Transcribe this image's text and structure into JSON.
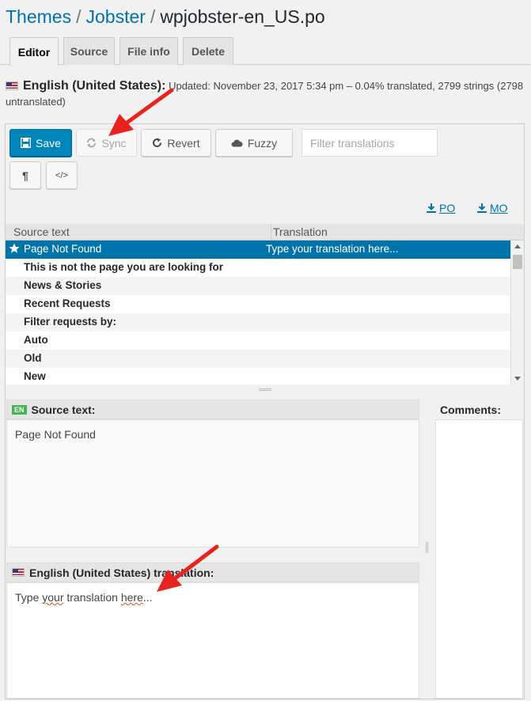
{
  "breadcrumb": {
    "item1": "Themes",
    "sep1": "/",
    "item2": "Jobster",
    "sep2": "/",
    "current": "wpjobster-en_US.po"
  },
  "tabs": [
    {
      "label": "Editor",
      "active": true
    },
    {
      "label": "Source",
      "active": false
    },
    {
      "label": "File info",
      "active": false
    },
    {
      "label": "Delete",
      "active": false
    }
  ],
  "status": {
    "language": "English (United States):",
    "details": "Updated: November 23, 2017 5:34 pm – 0.04% translated, 2799 strings (2798 untranslated)"
  },
  "toolbar": {
    "save_label": "Save",
    "sync_label": "Sync",
    "revert_label": "Revert",
    "fuzzy_label": "Fuzzy",
    "filter_placeholder": "Filter translations",
    "pilcrow_glyph": "¶",
    "code_glyph": "</>"
  },
  "downloads": {
    "po_label": "PO",
    "mo_label": "MO"
  },
  "list": {
    "header_source": "Source text",
    "header_translation": "Translation",
    "rows": [
      {
        "source": "Page Not Found",
        "translation": "Type your translation here...",
        "selected": true
      },
      {
        "source": "This is not the page you are looking for",
        "translation": ""
      },
      {
        "source": "News & Stories",
        "translation": ""
      },
      {
        "source": "Recent Requests",
        "translation": ""
      },
      {
        "source": "Filter requests by:",
        "translation": ""
      },
      {
        "source": "Auto",
        "translation": ""
      },
      {
        "source": "Old",
        "translation": ""
      },
      {
        "source": "New",
        "translation": ""
      }
    ]
  },
  "source_panel": {
    "badge": "EN",
    "title": "Source text:",
    "text": "Page Not Found"
  },
  "comments_panel": {
    "title": "Comments:"
  },
  "translation_panel": {
    "title": "English (United States) translation:",
    "text_part1": "Type ",
    "text_part2": "your",
    "text_part3": " translation ",
    "text_part4": "here",
    "text_part5": "..."
  },
  "colors": {
    "accent": "#0073aa",
    "primary_button": "#0085ba",
    "annotation_arrow": "#e8231e",
    "en_badge": "#46b450"
  }
}
